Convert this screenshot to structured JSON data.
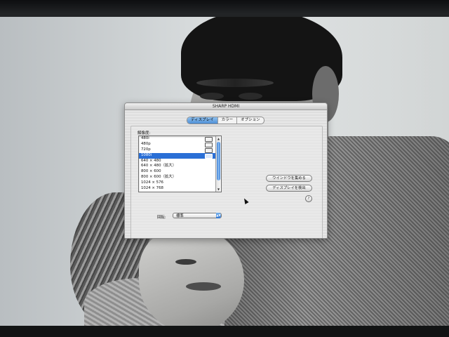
{
  "window": {
    "title": "SHARP HDMI",
    "tabs": [
      {
        "label": "ディスプレイ",
        "active": true
      },
      {
        "label": "カラー",
        "active": false
      },
      {
        "label": "オプション",
        "active": false
      }
    ],
    "resolution_label": "解像度:",
    "resolutions": [
      {
        "label": "480i",
        "tv_icon": true,
        "selected": false
      },
      {
        "label": "480p",
        "tv_icon": true,
        "selected": false
      },
      {
        "label": "720p",
        "tv_icon": true,
        "selected": false
      },
      {
        "label": "1080i",
        "tv_icon": true,
        "selected": true
      },
      {
        "label": "640 × 480",
        "tv_icon": false,
        "selected": false
      },
      {
        "label": "640 × 480（拡大）",
        "tv_icon": false,
        "selected": false
      },
      {
        "label": "800 × 600",
        "tv_icon": false,
        "selected": false
      },
      {
        "label": "800 × 600（拡大）",
        "tv_icon": false,
        "selected": false
      },
      {
        "label": "1024 × 576",
        "tv_icon": false,
        "selected": false
      },
      {
        "label": "1024 × 768",
        "tv_icon": false,
        "selected": false
      }
    ],
    "gather_windows_button": "ウインドウを集める",
    "detect_displays_button": "ディスプレイを検出",
    "help_label": "?",
    "rotation_label": "回転:",
    "rotation_value": "標準"
  },
  "colors": {
    "selection": "#2a6fd6",
    "accent": "#4e8fd5"
  }
}
